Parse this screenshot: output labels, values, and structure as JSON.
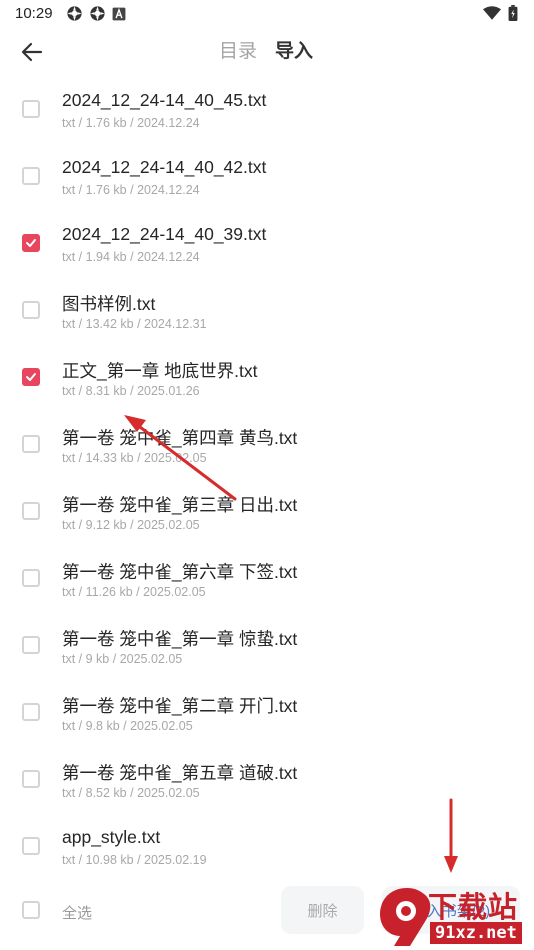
{
  "status_bar": {
    "time": "10:29",
    "left_icons": [
      "settings-icon",
      "settings-icon",
      "font-icon"
    ],
    "right_icons": [
      "wifi-icon",
      "battery-icon"
    ]
  },
  "header": {
    "back_icon": "arrow-left-icon",
    "tabs": [
      {
        "label": "目录",
        "active": false
      },
      {
        "label": "导入",
        "active": true
      }
    ]
  },
  "files": [
    {
      "name": "2024_12_24-14_40_45.txt",
      "type": "txt",
      "size": "1.76 kb",
      "date": "2024.12.24",
      "checked": false
    },
    {
      "name": "2024_12_24-14_40_42.txt",
      "type": "txt",
      "size": "1.76 kb",
      "date": "2024.12.24",
      "checked": false
    },
    {
      "name": "2024_12_24-14_40_39.txt",
      "type": "txt",
      "size": "1.94 kb",
      "date": "2024.12.24",
      "checked": true
    },
    {
      "name": "图书样例.txt",
      "type": "txt",
      "size": "13.42 kb",
      "date": "2024.12.31",
      "checked": false
    },
    {
      "name": "正文_第一章 地底世界.txt",
      "type": "txt",
      "size": "8.31 kb",
      "date": "2025.01.26",
      "checked": true
    },
    {
      "name": "第一卷 笼中雀_第四章 黄鸟.txt",
      "type": "txt",
      "size": "14.33 kb",
      "date": "2025.02.05",
      "checked": false
    },
    {
      "name": "第一卷 笼中雀_第三章 日出.txt",
      "type": "txt",
      "size": "9.12 kb",
      "date": "2025.02.05",
      "checked": false
    },
    {
      "name": "第一卷 笼中雀_第六章 下签.txt",
      "type": "txt",
      "size": "11.26 kb",
      "date": "2025.02.05",
      "checked": false
    },
    {
      "name": "第一卷 笼中雀_第一章 惊蛰.txt",
      "type": "txt",
      "size": "9 kb",
      "date": "2025.02.05",
      "checked": false
    },
    {
      "name": "第一卷 笼中雀_第二章 开门.txt",
      "type": "txt",
      "size": "9.8 kb",
      "date": "2025.02.05",
      "checked": false
    },
    {
      "name": "第一卷 笼中雀_第五章 道破.txt",
      "type": "txt",
      "size": "8.52 kb",
      "date": "2025.02.05",
      "checked": false
    },
    {
      "name": "app_style.txt",
      "type": "txt",
      "size": "10.98 kb",
      "date": "2025.02.19",
      "checked": false
    }
  ],
  "bottom_bar": {
    "select_all_label": "全选",
    "delete_label": "删除",
    "add_to_shelf_label": "加入书架(2)"
  },
  "watermark": {
    "top_text": "下载站",
    "bottom_text": "91xz.net"
  },
  "colors": {
    "accent": "#e8455e",
    "link": "#4a78c8",
    "annotation_arrow": "#d62c2c",
    "watermark_red": "#c7222b"
  }
}
